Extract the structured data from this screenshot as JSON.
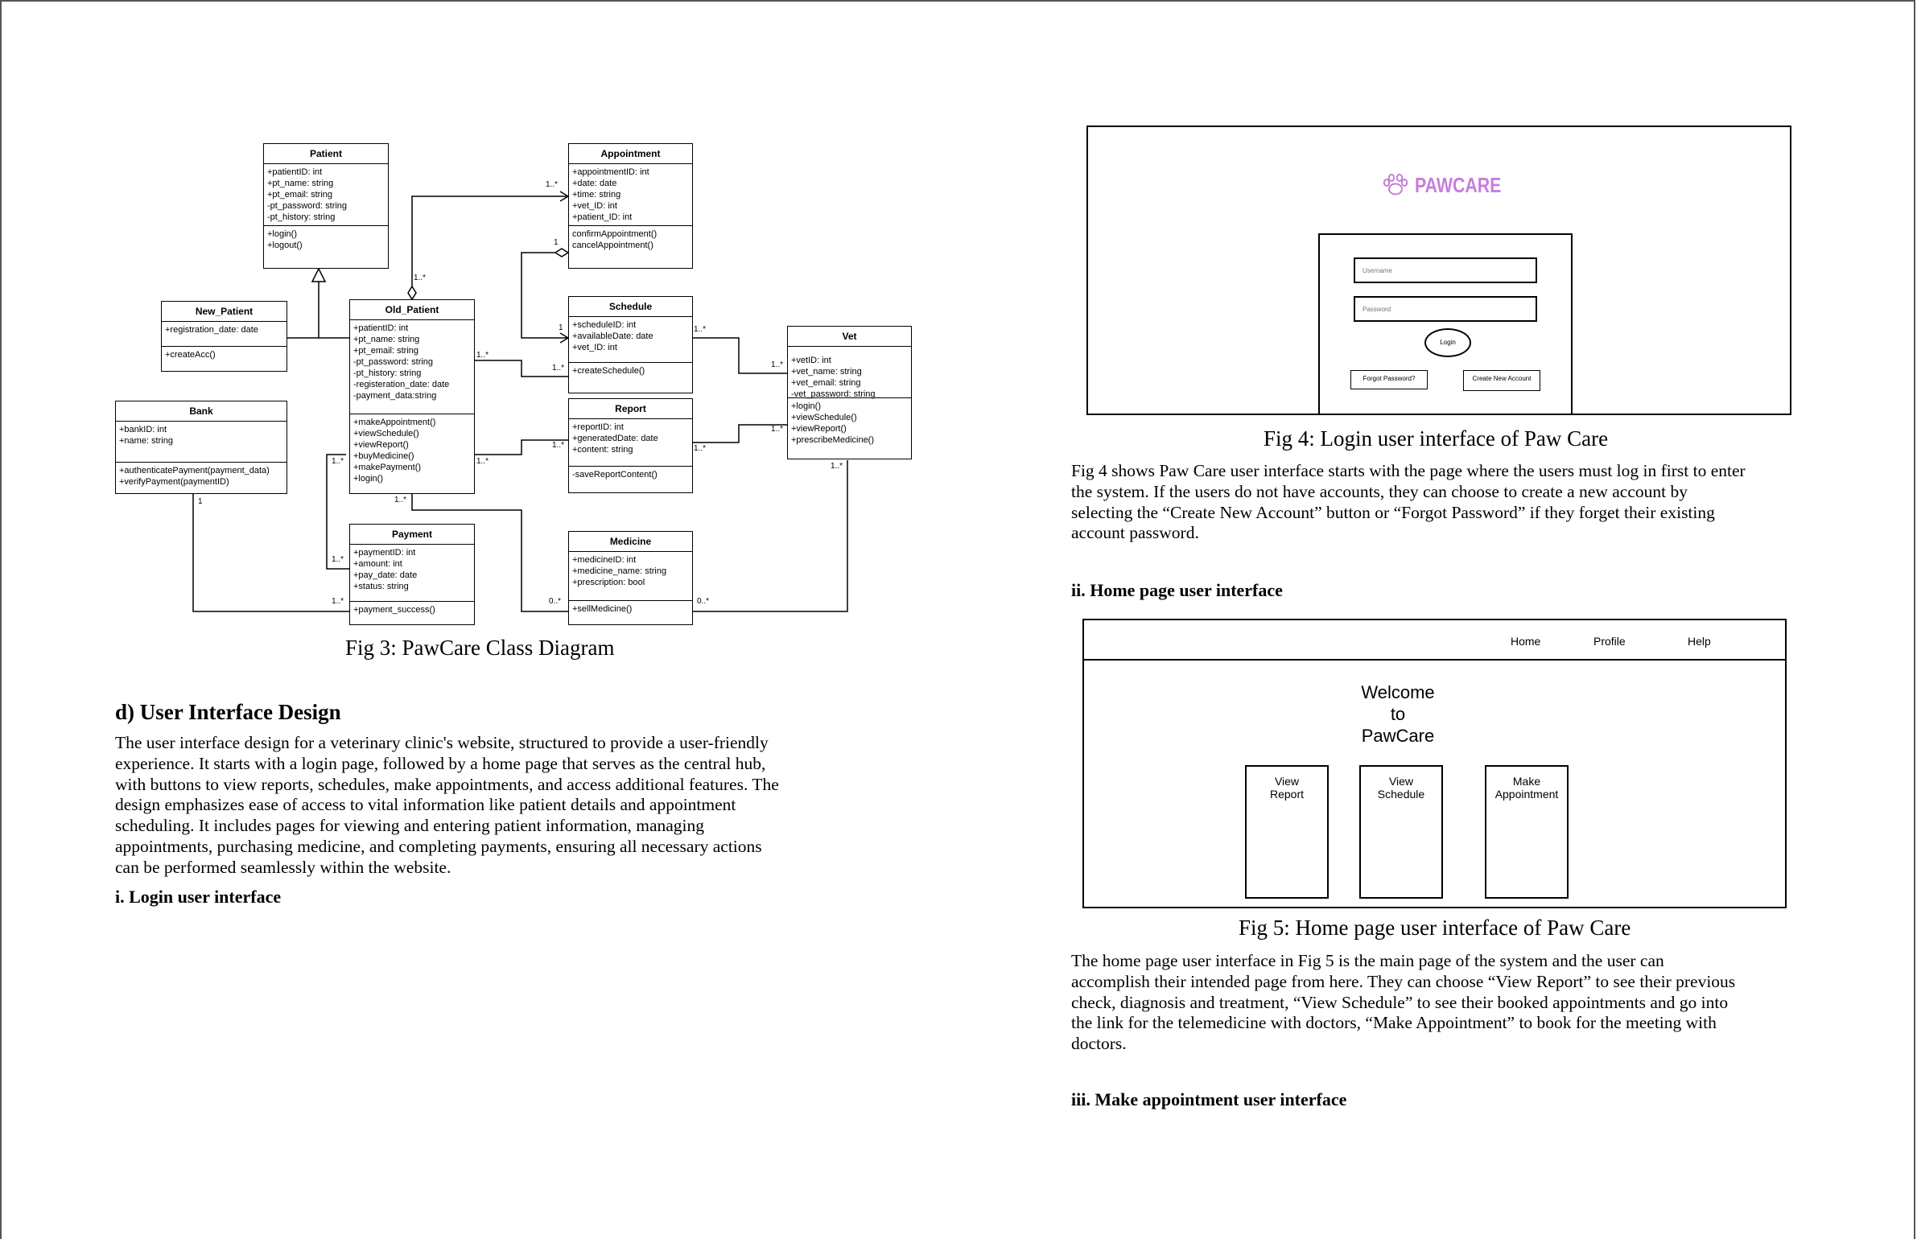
{
  "diagram": {
    "classes": {
      "patient": {
        "name": "Patient",
        "attrs": [
          "+patientID: int",
          "+pt_name: string",
          "+pt_email: string",
          "-pt_password: string",
          "-pt_history: string"
        ],
        "ops": [
          "+login()",
          "+logout()"
        ]
      },
      "appointment": {
        "name": "Appointment",
        "attrs": [
          "+appointmentID: int",
          "+date: date",
          "+time: string",
          "+vet_ID: int",
          "+patient_ID: int"
        ],
        "ops": [
          "confirmAppointment()",
          "cancelAppointment()"
        ]
      },
      "new_patient": {
        "name": "New_Patient",
        "attrs": [
          "+registration_date: date"
        ],
        "ops": [
          "+createAcc()"
        ]
      },
      "old_patient": {
        "name": "Old_Patient",
        "attrs": [
          "+patientID: int",
          "+pt_name: string",
          "+pt_email: string",
          "-pt_password: string",
          "-pt_history: string",
          "-registeration_date: date",
          "-payment_data:string"
        ],
        "ops": [
          "+makeAppointment()",
          "+viewSchedule()",
          "+viewReport()",
          "+buyMedicine()",
          "+makePayment()",
          "+login()"
        ]
      },
      "schedule": {
        "name": "Schedule",
        "attrs": [
          "+scheduleID: int",
          "+availableDate: date",
          "+vet_ID: int"
        ],
        "ops": [
          "+createSchedule()"
        ]
      },
      "vet": {
        "name": "Vet",
        "attrs": [
          "+vetID: int",
          "+vet_name: string",
          "+vet_email: string",
          "-vet_password: string"
        ],
        "ops": [
          "+login()",
          "+viewSchedule()",
          "+viewReport()",
          "+prescribeMedicine()"
        ]
      },
      "bank": {
        "name": "Bank",
        "attrs": [
          "+bankID: int",
          "+name: string"
        ],
        "ops": [
          "+authenticatePayment(payment_data)",
          "+verifyPayment(paymentID)"
        ]
      },
      "report": {
        "name": "Report",
        "attrs": [
          "+reportID: int",
          "+generatedDate: date",
          "+content: string"
        ],
        "ops": [
          "-saveReportContent()"
        ]
      },
      "payment": {
        "name": "Payment",
        "attrs": [
          "+paymentID: int",
          "+amount: int",
          "+pay_date: date",
          "+status: string"
        ],
        "ops": [
          "+payment_success()"
        ]
      },
      "medicine": {
        "name": "Medicine",
        "attrs": [
          "+medicineID: int",
          "+medicine_name: string",
          "+prescription: bool"
        ],
        "ops": [
          "+sellMedicine()"
        ]
      }
    },
    "multiplicities": {
      "m1": "1..*",
      "m2": "1..*",
      "m3": "1",
      "m4": "1",
      "m5": "1..*",
      "m6": "1..*",
      "m7": "1..*",
      "m8": "1..*",
      "m9": "1..*",
      "m10": "1..*",
      "m11": "1..*",
      "m12": "1..*",
      "m13": "1..*",
      "m14": "1..*",
      "m15": "1..*",
      "m16": "0..*",
      "m17": "0..*",
      "m18": "1..*",
      "m19": "1"
    }
  },
  "captions": {
    "fig3": "Fig 3: PawCare Class Diagram",
    "fig4": "Fig 4: Login user interface of Paw Care",
    "fig5": "Fig 5: Home page user interface of Paw Care"
  },
  "section_d": {
    "heading": "d) User Interface Design",
    "lines": [
      "The user interface design for a veterinary clinic's website, structured to provide a user-friendly",
      "experience. It starts with a login page, followed by a home page that serves as the central hub,",
      "with buttons to view reports, schedules, make appointments, and access additional features. The",
      "design emphasizes ease of access to vital information like patient details and appointment",
      "scheduling. It includes pages for viewing and entering patient information, managing",
      "appointments, purchasing medicine, and completing payments, ensuring all necessary actions",
      "can be performed seamlessly within the website."
    ],
    "sub_i": "i. Login user interface"
  },
  "login_mock": {
    "logo_text": "PAWCARE",
    "username_placeholder": "Username",
    "password_placeholder": "Password",
    "login_label": "Login",
    "forgot_label": "Forgot Password?",
    "create_label": "Create New Account"
  },
  "fig4_text": [
    "Fig 4 shows Paw Care user interface starts with the page where the users must log in first to enter",
    "the system. If the users do not have accounts, they can choose to create a new account by",
    "selecting the “Create New Account” button or “Forgot Password” if they forget their existing",
    "account password."
  ],
  "sub_ii": "ii. Home page user interface",
  "home_mock": {
    "nav": [
      "Home",
      "Profile",
      "Help"
    ],
    "welcome": [
      "Welcome",
      "to",
      "PawCare"
    ],
    "cards": [
      [
        "View",
        "Report"
      ],
      [
        "View",
        "Schedule"
      ],
      [
        "Make",
        "Appointment"
      ]
    ]
  },
  "fig5_text": [
    "The home page user interface in Fig 5 is the main page of the system and the user can",
    "accomplish their intended page from here. They can choose “View Report” to see their previous",
    "check, diagnosis and treatment, “View Schedule” to see their booked appointments and go into",
    "the link for the telemedicine with doctors, “Make Appointment” to book for the meeting with",
    "doctors."
  ],
  "sub_iii": "iii. Make appointment user interface",
  "colors": {
    "logo": "#c77ddb",
    "border": "#000000"
  }
}
